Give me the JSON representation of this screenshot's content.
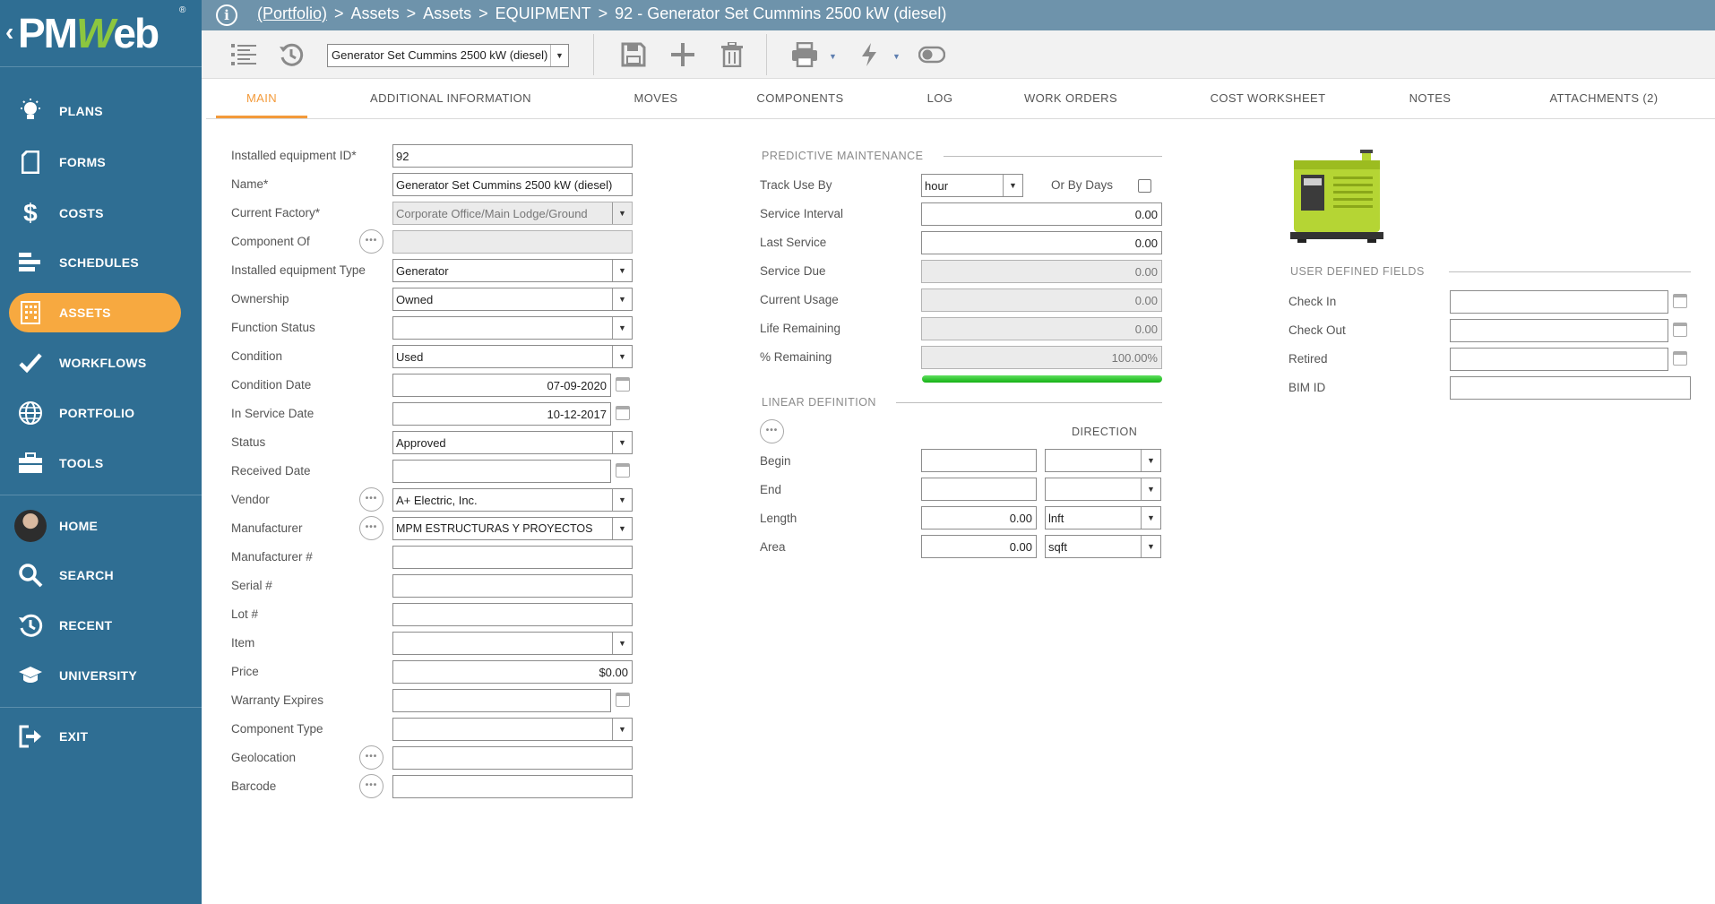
{
  "app": {
    "name": "PMWeb"
  },
  "breadcrumb": {
    "portfolio": "(Portfolio)",
    "items": [
      "Assets",
      "Assets",
      "EQUIPMENT",
      "92 - Generator Set Cummins 2500 kW (diesel)"
    ],
    "separator": ">"
  },
  "sidebar": {
    "items": [
      {
        "label": "PLANS",
        "icon": "lightbulb-icon"
      },
      {
        "label": "FORMS",
        "icon": "document-icon"
      },
      {
        "label": "COSTS",
        "icon": "dollar-icon"
      },
      {
        "label": "SCHEDULES",
        "icon": "gantt-icon"
      },
      {
        "label": "ASSETS",
        "icon": "building-icon",
        "active": true
      },
      {
        "label": "WORKFLOWS",
        "icon": "checkmark-icon"
      },
      {
        "label": "PORTFOLIO",
        "icon": "globe-icon"
      },
      {
        "label": "TOOLS",
        "icon": "toolbox-icon"
      },
      {
        "label": "HOME",
        "icon": "avatar"
      },
      {
        "label": "SEARCH",
        "icon": "search-icon"
      },
      {
        "label": "RECENT",
        "icon": "history-icon"
      },
      {
        "label": "UNIVERSITY",
        "icon": "graduation-cap-icon"
      },
      {
        "label": "EXIT",
        "icon": "exit-icon"
      }
    ]
  },
  "toolbar": {
    "record_select": "Generator Set Cummins 2500 kW (diesel)"
  },
  "tabs": [
    "MAIN",
    "ADDITIONAL INFORMATION",
    "MOVES",
    "COMPONENTS",
    "LOG",
    "WORK ORDERS",
    "COST WORKSHEET",
    "NOTES",
    "ATTACHMENTS (2)"
  ],
  "main": {
    "fields": [
      {
        "label": "Installed equipment ID*",
        "value": "92"
      },
      {
        "label": "Name*",
        "value": "Generator Set Cummins 2500 kW (diesel)"
      },
      {
        "label": "Current Factory*",
        "value": "Corporate Office/Main Lodge/Ground"
      },
      {
        "label": "Component Of",
        "value": ""
      },
      {
        "label": "Installed equipment Type",
        "value": "Generator"
      },
      {
        "label": "Ownership",
        "value": "Owned"
      },
      {
        "label": "Function Status",
        "value": ""
      },
      {
        "label": "Condition",
        "value": "Used"
      },
      {
        "label": "Condition Date",
        "value": "07-09-2020"
      },
      {
        "label": "In Service Date",
        "value": "10-12-2017"
      },
      {
        "label": "Status",
        "value": "Approved"
      },
      {
        "label": "Received Date",
        "value": ""
      },
      {
        "label": "Vendor",
        "value": "A+ Electric, Inc."
      },
      {
        "label": "Manufacturer",
        "value": "MPM ESTRUCTURAS Y PROYECTOS"
      },
      {
        "label": "Manufacturer #",
        "value": ""
      },
      {
        "label": "Serial #",
        "value": ""
      },
      {
        "label": "Lot #",
        "value": ""
      },
      {
        "label": "Item",
        "value": ""
      },
      {
        "label": "Price",
        "value": "$0.00"
      },
      {
        "label": "Warranty Expires",
        "value": ""
      },
      {
        "label": "Component Type",
        "value": ""
      },
      {
        "label": "Geolocation",
        "value": ""
      },
      {
        "label": "Barcode",
        "value": ""
      }
    ]
  },
  "predictive": {
    "title": "PREDICTIVE MAINTENANCE",
    "track_use_by": {
      "label": "Track Use By",
      "value": "hour"
    },
    "or_by_days": {
      "label": "Or By Days",
      "checked": false
    },
    "rows": [
      {
        "label": "Service Interval",
        "value": "0.00"
      },
      {
        "label": "Last Service",
        "value": "0.00"
      },
      {
        "label": "Service Due",
        "value": "0.00"
      },
      {
        "label": "Current Usage",
        "value": "0.00"
      },
      {
        "label": "Life Remaining",
        "value": "0.00"
      },
      {
        "label": "% Remaining",
        "value": "100.00%"
      }
    ],
    "remaining_fraction": 1.0
  },
  "linear": {
    "title": "LINEAR DEFINITION",
    "direction_label": "DIRECTION",
    "rows": [
      {
        "label": "Begin",
        "value": "",
        "unit": ""
      },
      {
        "label": "End",
        "value": "",
        "unit": ""
      },
      {
        "label": "Length",
        "value": "0.00",
        "unit": "lnft"
      },
      {
        "label": "Area",
        "value": "0.00",
        "unit": "sqft"
      }
    ]
  },
  "user_defined": {
    "title": "USER DEFINED FIELDS",
    "fields": [
      {
        "label": "Check In",
        "value": ""
      },
      {
        "label": "Check Out",
        "value": ""
      },
      {
        "label": "Retired",
        "value": ""
      },
      {
        "label": "BIM ID",
        "value": ""
      }
    ]
  },
  "colors": {
    "sidebar": "#2f6e93",
    "accent": "#f7a940",
    "topbar": "#6e93ab",
    "progress": "#22bb22",
    "generator": "#b5d534"
  }
}
